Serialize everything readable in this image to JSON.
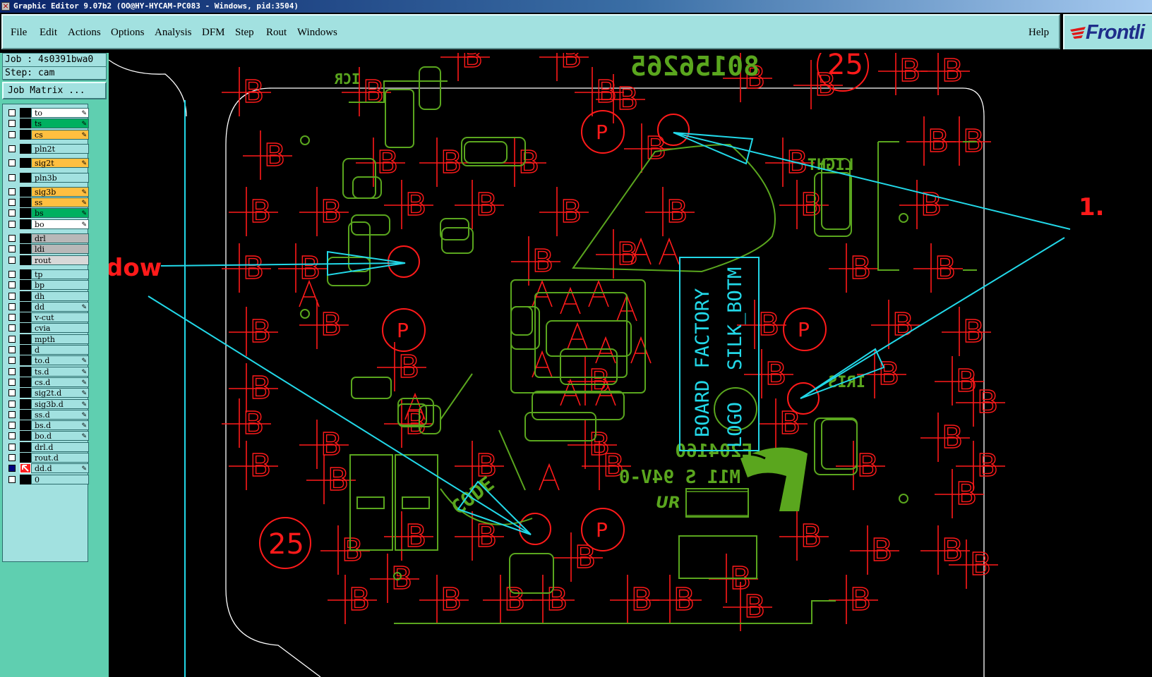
{
  "window": {
    "title": "Graphic Editor 9.07b2 (OO@HY-HYCAM-PC083 - Windows, pid:3504)"
  },
  "menu": {
    "items": [
      "File",
      "Edit",
      "Actions",
      "Options",
      "Analysis",
      "DFM",
      "Step",
      "Rout",
      "Windows"
    ],
    "help": "Help",
    "brand": "Frontli"
  },
  "job": {
    "job_label": "Job : 4s0391bwa0",
    "step_label": "Step: cam",
    "job_matrix_button": "Job Matrix ..."
  },
  "layers": [
    {
      "name": "to",
      "color": "#ffffff",
      "checked": false,
      "mark": true
    },
    {
      "name": "ts",
      "color": "#00b060",
      "checked": false,
      "mark": true
    },
    {
      "name": "cs",
      "color": "#ffbf40",
      "checked": false,
      "mark": true
    },
    {
      "name": "pln2t",
      "color": "#a2e1e0",
      "checked": false,
      "mark": false,
      "gap": true
    },
    {
      "name": "sig2t",
      "color": "#ffbf40",
      "checked": false,
      "mark": true,
      "gap": true
    },
    {
      "name": "pln3b",
      "color": "#a2e1e0",
      "checked": false,
      "mark": false,
      "gap": true
    },
    {
      "name": "sig3b",
      "color": "#ffbf40",
      "checked": false,
      "mark": true,
      "gap": true
    },
    {
      "name": "ss",
      "color": "#ffbf40",
      "checked": false,
      "mark": true
    },
    {
      "name": "bs",
      "color": "#00b060",
      "checked": false,
      "mark": true
    },
    {
      "name": "bo",
      "color": "#ffffff",
      "checked": false,
      "mark": true
    },
    {
      "name": "drl",
      "color": "#b8b8b8",
      "checked": false,
      "mark": false,
      "gap": true
    },
    {
      "name": "ldi",
      "color": "#b8b8b8",
      "checked": false,
      "mark": false
    },
    {
      "name": "rout",
      "color": "#d8d8d8",
      "checked": false,
      "mark": false
    },
    {
      "name": "tp",
      "color": "#a2e1e0",
      "checked": false,
      "mark": false,
      "gap": true
    },
    {
      "name": "bp",
      "color": "#a2e1e0",
      "checked": false,
      "mark": false
    },
    {
      "name": "dh",
      "color": "#a2e1e0",
      "checked": false,
      "mark": false
    },
    {
      "name": "dd",
      "color": "#a2e1e0",
      "checked": false,
      "mark": true
    },
    {
      "name": "v-cut",
      "color": "#a2e1e0",
      "checked": false,
      "mark": false
    },
    {
      "name": "cvia",
      "color": "#a2e1e0",
      "checked": false,
      "mark": false
    },
    {
      "name": "mpth",
      "color": "#a2e1e0",
      "checked": false,
      "mark": false
    },
    {
      "name": "d",
      "color": "#a2e1e0",
      "checked": false,
      "mark": false
    },
    {
      "name": "to.d",
      "color": "#a2e1e0",
      "checked": false,
      "mark": true
    },
    {
      "name": "ts.d",
      "color": "#a2e1e0",
      "checked": false,
      "mark": true
    },
    {
      "name": "cs.d",
      "color": "#a2e1e0",
      "checked": false,
      "mark": true
    },
    {
      "name": "sig2t.d",
      "color": "#a2e1e0",
      "checked": false,
      "mark": true
    },
    {
      "name": "sig3b.d",
      "color": "#a2e1e0",
      "checked": false,
      "mark": true
    },
    {
      "name": "ss.d",
      "color": "#a2e1e0",
      "checked": false,
      "mark": true
    },
    {
      "name": "bs.d",
      "color": "#a2e1e0",
      "checked": false,
      "mark": true
    },
    {
      "name": "bo.d",
      "color": "#a2e1e0",
      "checked": false,
      "mark": true
    },
    {
      "name": "drl.d",
      "color": "#a2e1e0",
      "checked": false,
      "mark": false
    },
    {
      "name": "rout.d",
      "color": "#a2e1e0",
      "checked": false,
      "mark": false
    },
    {
      "name": "dd.d",
      "color": "#a2e1e0",
      "checked": true,
      "mark": true,
      "active": true
    },
    {
      "name": "0",
      "color": "#a2e1e0",
      "checked": false,
      "mark": false
    }
  ],
  "canvas": {
    "labels": {
      "dow": "dow",
      "num": "1.",
      "board_text_1": "BOARD FACTORY",
      "board_text_2": "SILK_BOTM",
      "board_text_3": "LOGO",
      "code": "CODE",
      "part_no": "80156265",
      "light": "LIGHT",
      "iris": "IRIS",
      "icr": "ICR",
      "e_number": "E204160",
      "rating": "M11 S 94V-0",
      "twenty_five": "25"
    },
    "colors": {
      "red": "#ff1a1a",
      "green": "#5aa61e",
      "cyan": "#22d8e8",
      "outline": "#ffffff"
    }
  }
}
